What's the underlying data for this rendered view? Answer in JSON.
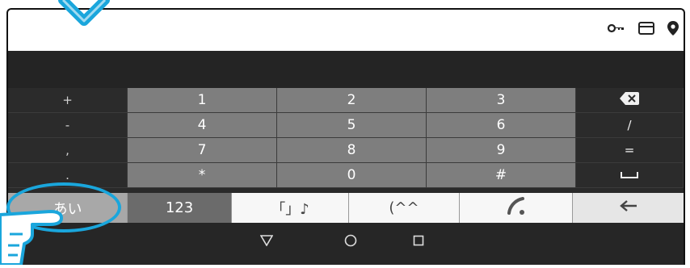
{
  "status_icons": [
    "key-icon",
    "card-icon",
    "location-pin-icon"
  ],
  "keypad": {
    "rows": [
      {
        "side": "+",
        "keys": [
          "1",
          "2",
          "3"
        ],
        "right": "backspace-icon"
      },
      {
        "side": "-",
        "keys": [
          "4",
          "5",
          "6"
        ],
        "right": "/"
      },
      {
        "side": ",",
        "keys": [
          "7",
          "8",
          "9"
        ],
        "right": "="
      },
      {
        "side": ".",
        "keys": [
          "*",
          "0",
          "#"
        ],
        "right": "space-icon"
      }
    ]
  },
  "bottom_row": {
    "kana_label": "あい",
    "num_label": "123",
    "symbols_label": "「」♪",
    "emoticon_label": "(^^",
    "handwriting_icon": "handwriting-icon",
    "enter_icon": "enter-arrow-icon"
  },
  "navbar": [
    "back-icon",
    "home-icon",
    "recents-icon"
  ],
  "colors": {
    "highlight": "#1aa6dc"
  }
}
